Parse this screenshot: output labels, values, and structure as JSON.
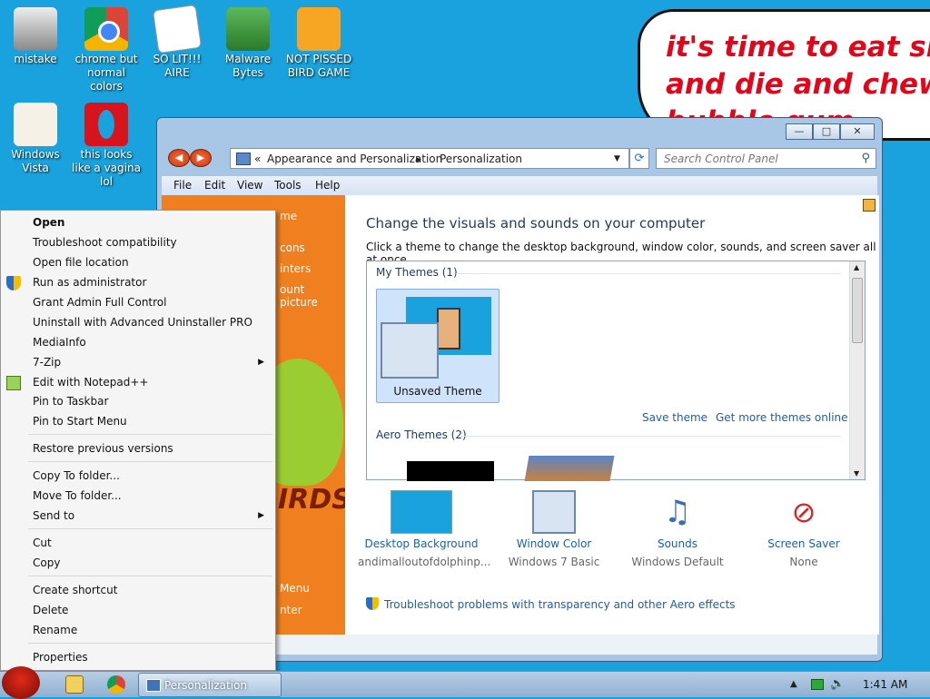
{
  "desktop": {
    "icons": [
      {
        "label": "mistake"
      },
      {
        "label": "chrome but normal colors"
      },
      {
        "label": "SO LIT!!! AIRE"
      },
      {
        "label": "Malware Bytes"
      },
      {
        "label": "NOT PISSED BIRD GAME"
      },
      {
        "label": "Windows Vista"
      },
      {
        "label": "this looks like a vagina lol"
      }
    ],
    "bubble_text": [
      "it's time to eat shit",
      "and die and chew",
      "bubble gum"
    ]
  },
  "window": {
    "address": {
      "sep": "«",
      "part1": "Appearance and Personalization",
      "part2": "Personalization"
    },
    "search_placeholder": "Search Control Panel",
    "menu": [
      "File",
      "Edit",
      "View",
      "Tools",
      "Help"
    ],
    "left_pane": [
      "me",
      "cons",
      "inters",
      "ount picture",
      "IRDS",
      "Menu",
      "nter"
    ],
    "title": "Change the visuals and sounds on your computer",
    "subtitle": "Click a theme to change the desktop background, window color, sounds, and screen saver all at once.",
    "my_themes_header": "My Themes (1)",
    "current_theme": "Unsaved Theme",
    "save_theme": "Save theme",
    "get_more": "Get more themes online",
    "aero_header": "Aero Themes (2)",
    "options": [
      {
        "label": "Desktop Background",
        "value": "andimalloutofdolphinp..."
      },
      {
        "label": "Window Color",
        "value": "Windows 7 Basic"
      },
      {
        "label": "Sounds",
        "value": "Windows Default"
      },
      {
        "label": "Screen Saver",
        "value": "None"
      }
    ],
    "troubleshoot": "Troubleshoot problems with transparency and other Aero effects"
  },
  "context_menu": {
    "items": [
      "Open",
      "Troubleshoot compatibility",
      "Open file location",
      "Run as administrator",
      "Grant Admin Full Control",
      "Uninstall with Advanced Uninstaller PRO",
      "MediaInfo",
      "7-Zip",
      "Edit with Notepad++",
      "Pin to Taskbar",
      "Pin to Start Menu",
      "Restore previous versions",
      "Copy To folder...",
      "Move To folder...",
      "Send to",
      "Cut",
      "Copy",
      "Create shortcut",
      "Delete",
      "Rename",
      "Properties"
    ]
  },
  "taskbar": {
    "task_label": "Personalization",
    "clock": "1:41 AM"
  }
}
